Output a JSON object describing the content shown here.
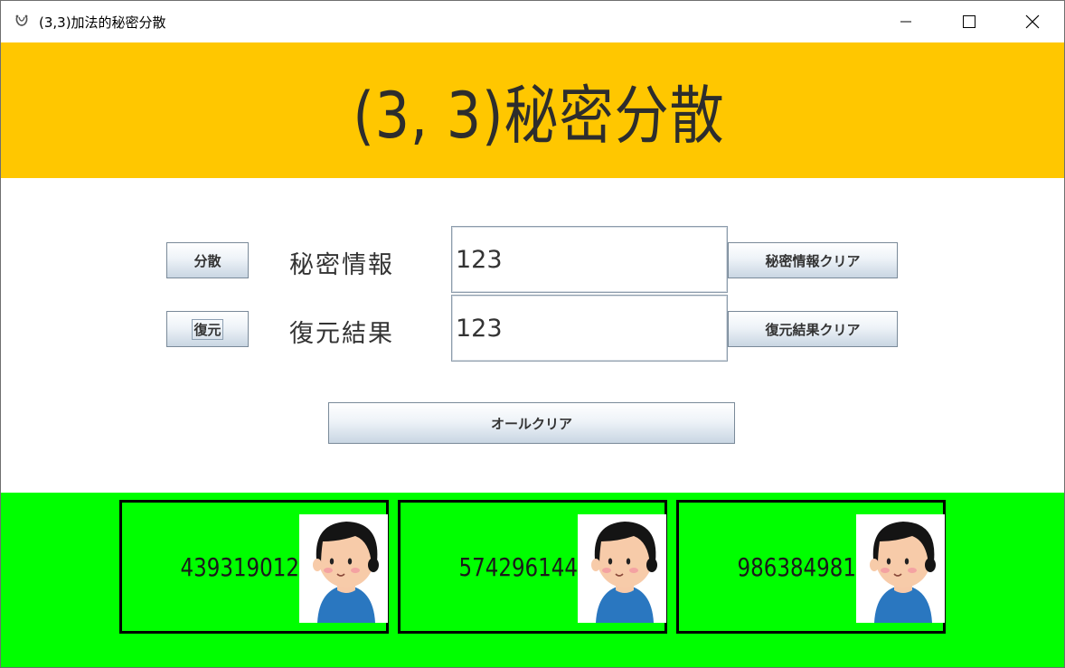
{
  "window": {
    "title": "(3,3)加法的秘密分散",
    "icon": "app-icon",
    "controls": [
      "minimize-icon",
      "maximize-icon",
      "close-icon"
    ]
  },
  "header": {
    "title": "(3, 3)秘密分散",
    "background": "#ffc700"
  },
  "form": {
    "split_button": "分散",
    "secret_label": "秘密情報",
    "secret_value": "123",
    "clear_secret_button": "秘密情報クリア",
    "restore_button": "復元",
    "result_label": "復元結果",
    "result_value": "123",
    "clear_result_button": "復元結果クリア",
    "clear_all_button": "オールクリア"
  },
  "shares": {
    "background": "#00ff00",
    "items": [
      {
        "value": "439319012",
        "avatar": "person-avatar"
      },
      {
        "value": "574296144",
        "avatar": "person-avatar"
      },
      {
        "value": "986384981",
        "avatar": "person-avatar"
      }
    ]
  }
}
